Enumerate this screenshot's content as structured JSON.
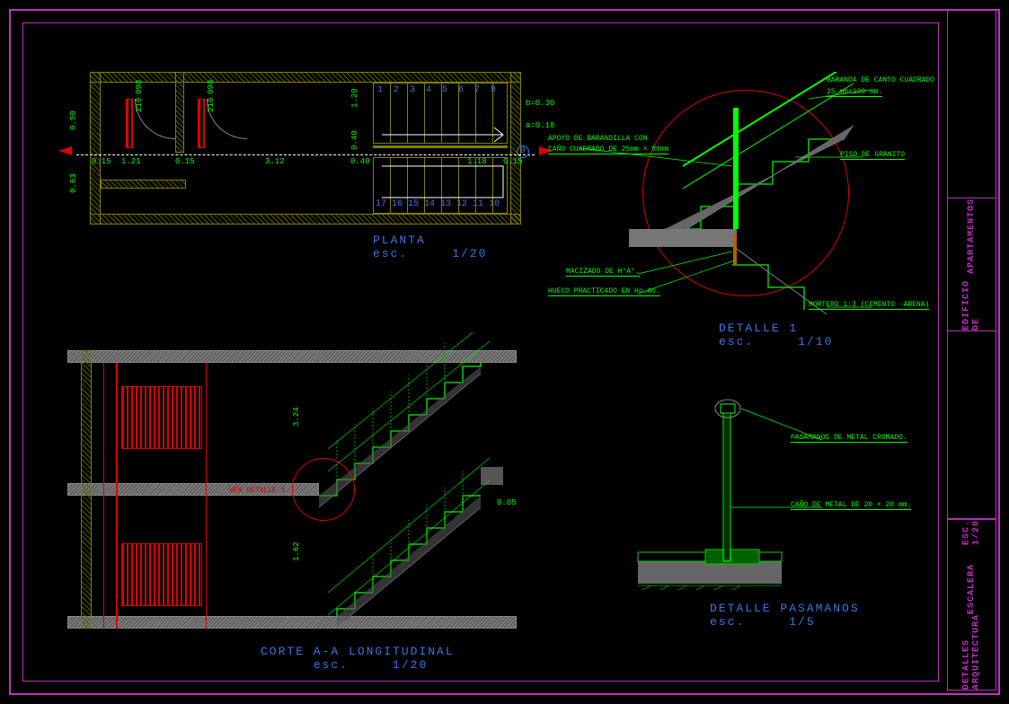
{
  "sheet": {
    "project_line1": "EDIFICIO DE",
    "project_line2": "APARTAMENTOS",
    "title_line1": "DETALLES ARQUITECTURA",
    "title_line2": "ESCALERA",
    "scale_label": "ESC. 1/20"
  },
  "views": {
    "plan": {
      "title": "PLANTA",
      "scale_prefix": "esc.",
      "scale": "1/20",
      "dims": {
        "w_121": "1.21",
        "w_015a": "0.15",
        "w_015b": "0.15",
        "w_312": "3.12",
        "w_040": "0.40",
        "w_118": "1.18",
        "w_015c": "0.15",
        "door1_w": "090",
        "door1_h": "210",
        "door2_w": "090",
        "door2_h": "210",
        "h_120": "1.20",
        "h_040": "0.40",
        "h_063": "0.63",
        "h_090": "0.90",
        "b_label": "b=0.30",
        "a_label": "a=0.18"
      },
      "steps_top": [
        "1",
        "2",
        "3",
        "4",
        "5",
        "6",
        "7",
        "8"
      ],
      "landing_num": "9",
      "steps_bottom": [
        "17",
        "16",
        "15",
        "14",
        "13",
        "12",
        "11",
        "10"
      ]
    },
    "section": {
      "title": "CORTE A-A LONGITUDINAL",
      "scale_prefix": "esc.",
      "scale": "1/20",
      "dims": {
        "h_324": "3.24",
        "h_162": "1.62",
        "h_005": "0.05"
      },
      "note_detail": "VER DETALLE 1"
    },
    "detail1": {
      "title": "DETALLE  1",
      "scale_prefix": "esc.",
      "scale": "1/10",
      "annotations": {
        "baranda": "BARANDA DE CANTO CUADRADO",
        "baranda_dim": "25 mm×190 mm.",
        "apoyo": "APOYO DE BARANDILLA CON",
        "apoyo2": "CAÑO CUADRADO DE 25mm × 80mm",
        "piso": "PISO DE GRANITO",
        "macizado": "MACIZADO DE H°A°.",
        "hueco": "HUECO PRACTICADO EN Ho.Ao.",
        "mortero": "MORTERO 1:3 (CEMENTO -ARENA)"
      }
    },
    "detail_handrail": {
      "title": "DETALLE PASAMANOS",
      "scale_prefix": "esc.",
      "scale": "1/5",
      "annotations": {
        "pasamanos": "PASAMANOS DE METAL CROMADO.",
        "cano": "CAÑO DE METAL DE  20 × 20 mm."
      }
    }
  },
  "colors": {
    "frame": "#c030c0",
    "title_text": "#3876e8",
    "dim": "#00ff00",
    "detail_circle": "#e00000",
    "wall": "#808000"
  }
}
